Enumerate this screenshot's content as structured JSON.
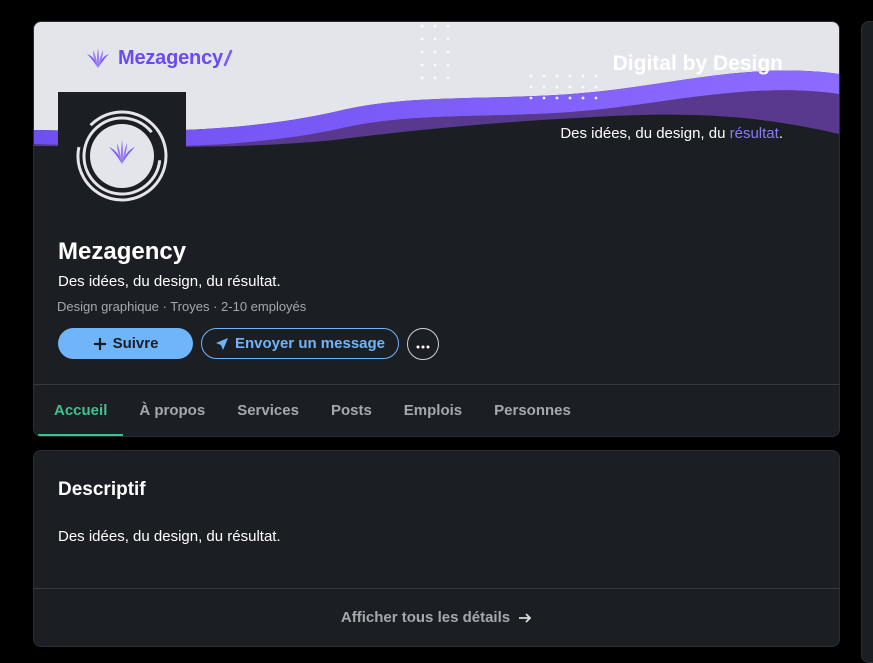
{
  "banner": {
    "logo_text": "Mezagency",
    "title": "Digital by Design",
    "subtitle_prefix": "Des idées, du design, du",
    "subtitle_highlight": "résultat",
    "subtitle_suffix": ".",
    "colors": {
      "accent": "#6a4bf0",
      "gradient_start": "#6f4ff2",
      "gradient_end": "#8c6cff",
      "background": "#e4e5ea"
    }
  },
  "company": {
    "name": "Mezagency",
    "tagline": "Des idées, du design, du résultat.",
    "meta": "Design graphique · Troyes · 2-10 employés"
  },
  "actions": {
    "follow_label": "Suivre",
    "follow_icon": "plus-icon",
    "message_label": "Envoyer un message",
    "message_icon": "send-icon",
    "more_icon": "more-horizontal-icon"
  },
  "tabs": [
    {
      "label": "Accueil",
      "active": true
    },
    {
      "label": "À propos"
    },
    {
      "label": "Services"
    },
    {
      "label": "Posts"
    },
    {
      "label": "Emplois"
    },
    {
      "label": "Personnes"
    }
  ],
  "description": {
    "title": "Descriptif",
    "text": "Des idées, du design, du résultat.",
    "link_label": "Afficher tous les détails",
    "link_icon": "arrow-right-icon"
  },
  "colors": {
    "page_bg": "#000000",
    "card_bg": "#1b1f23",
    "primary": "#70b5f9",
    "active_tab": "#43c08f",
    "muted_text": "#a5a8ac"
  }
}
